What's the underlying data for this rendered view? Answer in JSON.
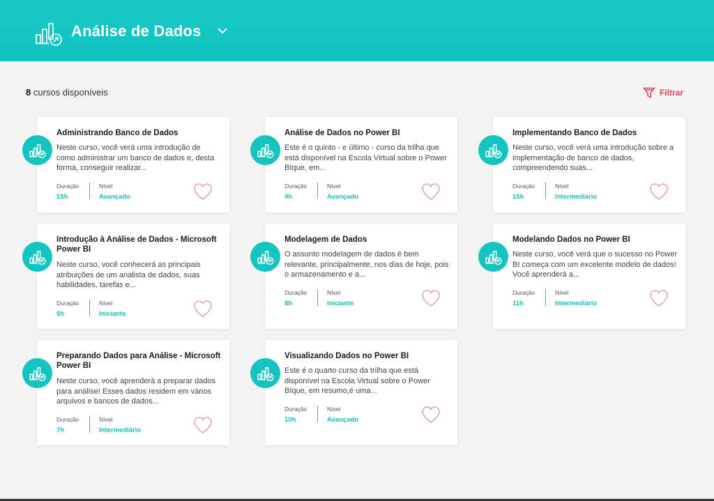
{
  "header": {
    "title": "Análise de Dados",
    "icon": "chart-growth-icon"
  },
  "summary": {
    "count": "8",
    "count_label": "cursos disponíveis"
  },
  "filter": {
    "label": "Filtrar",
    "icon": "funnel-icon"
  },
  "labels": {
    "duration": "Duração",
    "level": "Nível"
  },
  "colors": {
    "primary": "#14c4c1",
    "accent": "#e0405f",
    "heart": "#e8a0a5",
    "background": "#f3f3f3"
  },
  "courses": [
    {
      "title": "Administrando Banco de Dados",
      "description": "Neste curso, você verá uma introdução de como administrar um banco de dados e, desta forma, conseguir realizar...",
      "duration": "15h",
      "level": "Avançado"
    },
    {
      "title": "Análise de Dados no Power BI",
      "description": "Este é o quinto - e último - curso da trilha que está disponível na Escola Virtual sobre o Power BIque, em...",
      "duration": "4h",
      "level": "Avançado"
    },
    {
      "title": "Implementando Banco de Dados",
      "description": "Neste curso, você verá uma introdução sobre a implementação de banco de dados, compreendendo suas...",
      "duration": "15h",
      "level": "Intermediário"
    },
    {
      "title": "Introdução à Análise de Dados - Microsoft Power BI",
      "description": "Neste curso, você conhecerá as principais atribuições de um analista de dados, suas habilidades, tarefas e...",
      "duration": "5h",
      "level": "Iniciante"
    },
    {
      "title": "Modelagem de Dados",
      "description": "O assunto modelagem de dados é bem relevante, principalmente, nos dias de hoje, pois o armazenamento e a...",
      "duration": "8h",
      "level": "Iniciante"
    },
    {
      "title": "Modelando Dados no Power BI",
      "description": "Neste curso, você verá que o sucesso no Power BI começa com um excelente modelo de dados! Você aprenderá a...",
      "duration": "11h",
      "level": "Intermediário"
    },
    {
      "title": "Preparando Dados para Análise - Microsoft Power BI",
      "description": "Neste curso, você aprenderá a preparar dados para análise! Esses dados residem em vários arquivos e bancos de dados...",
      "duration": "7h",
      "level": "Intermediário"
    },
    {
      "title": "Visualizando Dados no Power BI",
      "description": "Este é o quarto curso da trilha que está disponível na Escola Virtual sobre o Power BIque, em resumo,é uma...",
      "duration": "10h",
      "level": "Avançado"
    }
  ]
}
